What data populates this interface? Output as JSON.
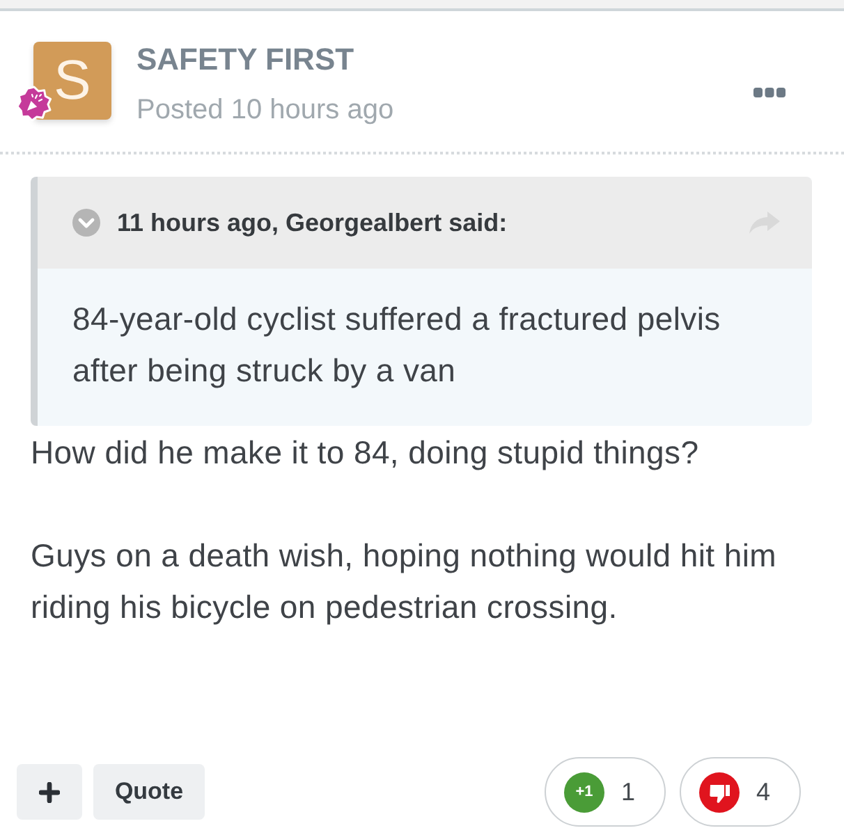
{
  "post": {
    "avatar_letter": "S",
    "author": "SAFETY FIRST",
    "posted": "Posted 10 hours ago"
  },
  "quote": {
    "header": "11 hours ago, Georgealbert said:",
    "text": "84-year-old cyclist suffered a fractured pelvis after being struck by a van"
  },
  "paragraphs": [
    "How did he make it to 84, doing stupid things?",
    "Guys on a death wish, hoping nothing would hit him riding his bicycle on pedestrian crossing."
  ],
  "actions": [
    {
      "kind": "multiquote"
    },
    {
      "kind": "quote",
      "label": "Quote"
    }
  ],
  "reactions": [
    {
      "kind": "upvote",
      "badge": "+1",
      "count": "1"
    },
    {
      "kind": "downvote",
      "count": "4"
    }
  ]
}
